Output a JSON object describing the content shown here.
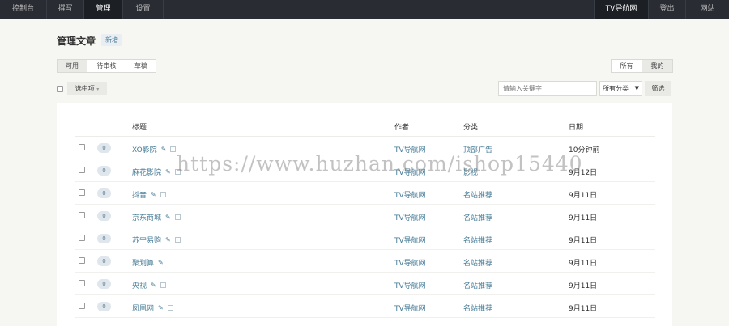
{
  "topnav": {
    "items": [
      {
        "label": "控制台"
      },
      {
        "label": "撰写"
      },
      {
        "label": "管理"
      },
      {
        "label": "设置"
      }
    ],
    "right": [
      {
        "label": "TV导航网"
      },
      {
        "label": "登出"
      },
      {
        "label": "网站"
      }
    ]
  },
  "page": {
    "title": "管理文章",
    "new_label": "新增"
  },
  "status_tabs": [
    "可用",
    "待审核",
    "草稿"
  ],
  "owner_tabs": [
    "所有",
    "我的"
  ],
  "bulk": {
    "label": "选中项"
  },
  "search": {
    "placeholder": "请输入关键字",
    "category": "所有分类",
    "filter_label": "筛选"
  },
  "table": {
    "headers": {
      "title": "标题",
      "author": "作者",
      "category": "分类",
      "date": "日期"
    },
    "rows": [
      {
        "comments": "0",
        "title": "XO影院",
        "author": "TV导航网",
        "category": "顶部广告",
        "date": "10分钟前"
      },
      {
        "comments": "0",
        "title": "麻花影院",
        "author": "TV导航网",
        "category": "影视",
        "date": "9月12日"
      },
      {
        "comments": "0",
        "title": "抖音",
        "author": "TV导航网",
        "category": "名站推荐",
        "date": "9月11日"
      },
      {
        "comments": "0",
        "title": "京东商城",
        "author": "TV导航网",
        "category": "名站推荐",
        "date": "9月11日"
      },
      {
        "comments": "0",
        "title": "苏宁易购",
        "author": "TV导航网",
        "category": "名站推荐",
        "date": "9月11日"
      },
      {
        "comments": "0",
        "title": "聚划算",
        "author": "TV导航网",
        "category": "名站推荐",
        "date": "9月11日"
      },
      {
        "comments": "0",
        "title": "央视",
        "author": "TV导航网",
        "category": "名站推荐",
        "date": "9月11日"
      },
      {
        "comments": "0",
        "title": "凤凰网",
        "author": "TV导航网",
        "category": "名站推荐",
        "date": "9月11日"
      }
    ]
  },
  "watermark": "https://www.huzhan.com/ishop15440"
}
